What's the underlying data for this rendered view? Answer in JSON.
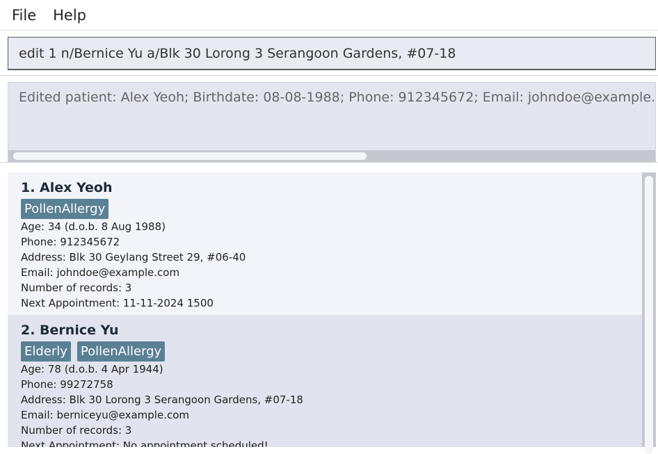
{
  "menu": {
    "file": "File",
    "help": "Help"
  },
  "command": {
    "value": "edit 1 n/Bernice Yu a/Blk 30 Lorong 3 Serangoon Gardens, #07-18"
  },
  "result": {
    "text": "Edited patient: Alex Yeoh; Birthdate: 08-08-1988; Phone: 912345672; Email: johndoe@example.com; A"
  },
  "patients": [
    {
      "title": "1.  Alex Yeoh",
      "tags": [
        "PollenAllergy"
      ],
      "age": "Age: 34   (d.o.b. 8 Aug 1988)",
      "phone": "Phone: 912345672",
      "address": "Address: Blk 30 Geylang Street 29, #06-40",
      "email": "Email: johndoe@example.com",
      "records": "Number of records: 3",
      "appointment": "Next Appointment: 11-11-2024 1500"
    },
    {
      "title": "2.  Bernice Yu",
      "tags": [
        "Elderly",
        "PollenAllergy"
      ],
      "age": "Age: 78   (d.o.b. 4 Apr 1944)",
      "phone": "Phone: 99272758",
      "address": "Address: Blk 30 Lorong 3 Serangoon Gardens, #07-18",
      "email": "Email: berniceyu@example.com",
      "records": "Number of records: 3",
      "appointment": "Next Appointment: No appointment scheduled!"
    }
  ]
}
